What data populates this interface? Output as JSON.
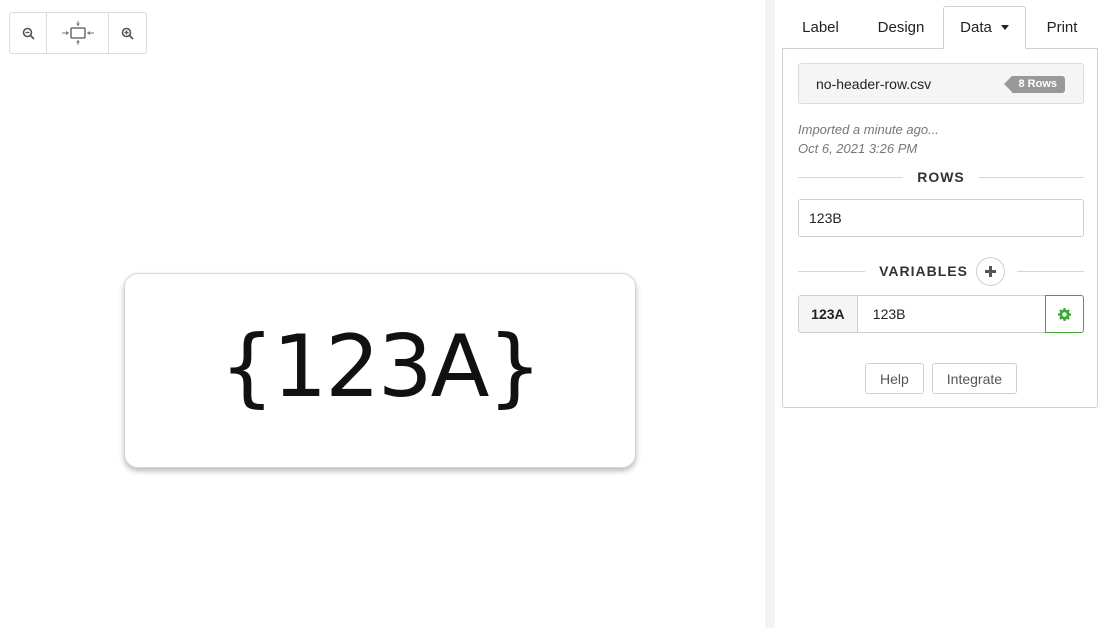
{
  "zoom_toolbar": {
    "zoom_out_icon": "zoom-out-icon",
    "fit_icon": "fit-to-screen-icon",
    "zoom_in_icon": "zoom-in-icon"
  },
  "label_preview": {
    "text": "{123A}"
  },
  "tabs": [
    {
      "label": "Label"
    },
    {
      "label": "Design"
    },
    {
      "label": "Data",
      "active": true
    },
    {
      "label": "Print"
    }
  ],
  "data_panel": {
    "file_name": "no-header-row.csv",
    "rows_badge": "8 Rows",
    "import_status": "Imported a minute ago...",
    "import_date": "Oct 6, 2021 3:26 PM",
    "rows_title": "ROWS",
    "row_value": "123B",
    "variables_title": "VARIABLES",
    "variables": [
      {
        "name": "123A",
        "value": "123B"
      }
    ],
    "help_label": "Help",
    "integrate_label": "Integrate"
  },
  "colors": {
    "accent_green": "#3aaa35",
    "badge_gray": "#999999"
  }
}
